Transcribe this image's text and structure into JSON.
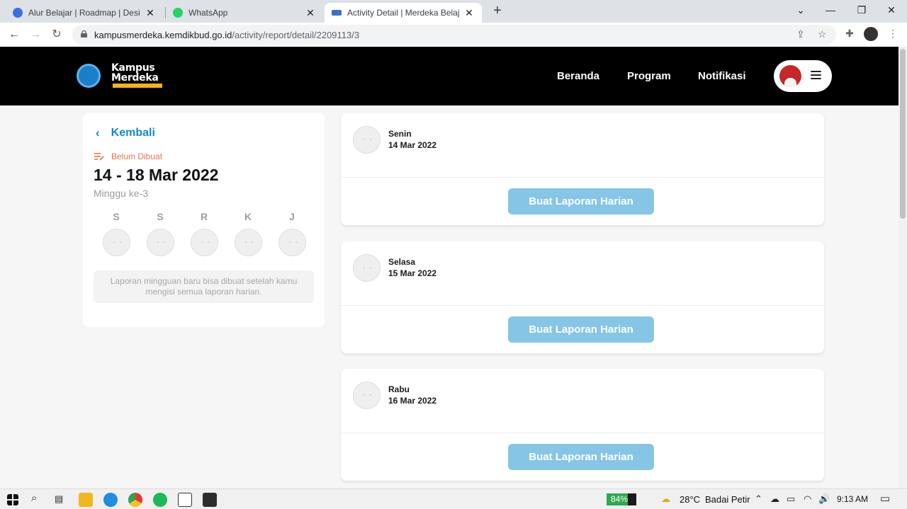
{
  "browser": {
    "tabs": [
      {
        "label": "Alur Belajar | Roadmap | Design &",
        "icon": "dicoding-icon",
        "color": "#3b6fe0"
      },
      {
        "label": "WhatsApp",
        "icon": "whatsapp-icon",
        "color": "#25d366"
      },
      {
        "label": "Activity Detail | Merdeka Belajar -",
        "icon": "kampus-merdeka-icon",
        "color": "#3c6fd1"
      }
    ],
    "url_host": "kampusmerdeka.kemdikbud.go.id",
    "url_path": "/activity/report/detail/2209113/3"
  },
  "header": {
    "logo_line1": "Kampus",
    "logo_line2": "Merdeka",
    "nav": [
      "Beranda",
      "Program",
      "Notifikasi"
    ]
  },
  "week_card": {
    "back_label": "Kembali",
    "status": "Belum Dibuat",
    "date_range": "14 - 18 Mar 2022",
    "week_label": "Minggu ke-3",
    "days": [
      "S",
      "S",
      "R",
      "K",
      "J"
    ],
    "note": "Laporan mingguan baru bisa dibuat setelah kamu mengisi semua laporan harian."
  },
  "daily_reports": [
    {
      "day": "Senin",
      "date": "14 Mar 2022",
      "button": "Buat Laporan Harian"
    },
    {
      "day": "Selasa",
      "date": "15 Mar 2022",
      "button": "Buat Laporan Harian"
    },
    {
      "day": "Rabu",
      "date": "16 Mar 2022",
      "button": "Buat Laporan Harian"
    }
  ],
  "taskbar": {
    "battery": "84%",
    "battery_level": 0.84,
    "temperature": "28°C",
    "weather": "Badai Petir",
    "time": "9:13 AM"
  },
  "colors": {
    "accent": "#0e8ccf",
    "status": "#e9744c",
    "button": "#86c5e6",
    "header_bg": "#000000"
  }
}
